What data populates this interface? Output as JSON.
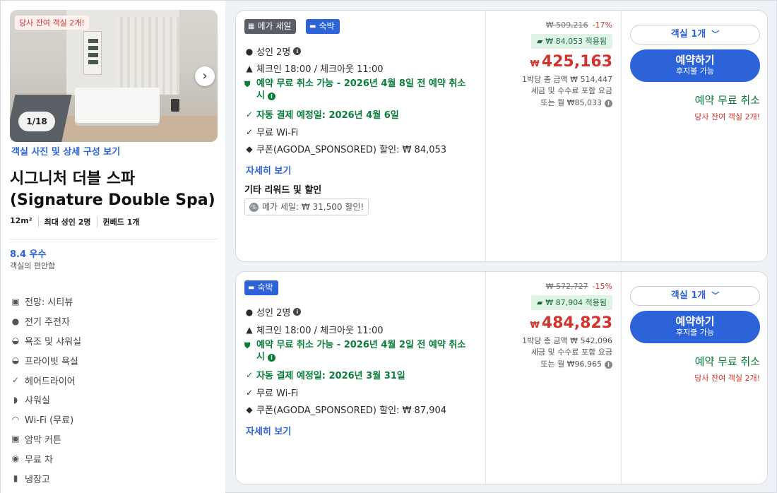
{
  "room": {
    "photo_badge": "당사 잔여 객실 2개!",
    "photo_counter": "1/18",
    "view_photos": "객실 사진 및 상세 구성 보기",
    "title": "시그니처 더블 스파 (Signature Double Spa)",
    "specs": [
      "12m²",
      "최대 성인 2명",
      "퀸베드 1개"
    ],
    "score": "8.4 우수",
    "score_sub": "객실의 편안함",
    "amenities": [
      {
        "icon": "view-icon",
        "label": "전망: 시티뷰"
      },
      {
        "icon": "plug-icon",
        "label": "전기 주전자"
      },
      {
        "icon": "bathtub-icon",
        "label": "욕조 및 샤워실"
      },
      {
        "icon": "bathtub-icon",
        "label": "프라이빗 욕실"
      },
      {
        "icon": "check-icon",
        "label": "헤어드라이어"
      },
      {
        "icon": "shower-icon",
        "label": "샤워실"
      },
      {
        "icon": "wifi-icon",
        "label": "Wi-Fi (무료)"
      },
      {
        "icon": "curtain-icon",
        "label": "암막 커튼"
      },
      {
        "icon": "tea-icon",
        "label": "무료 차"
      },
      {
        "icon": "fridge-icon",
        "label": "냉장고"
      }
    ]
  },
  "offers": [
    {
      "tags": [
        "메가 세일",
        "숙박"
      ],
      "adults": "성인 2명",
      "checkin": "체크인 18:00 / 체크아웃 11:00",
      "free_cancel": "예약 무료 취소 가능 - 2026년 4월 8일 전 예약 취소 시",
      "auto_pay": "자동 결제 예정일: 2026년 4월 6일",
      "wifi": "무료 Wi-Fi",
      "coupon": "쿠폰(AGODA_SPONSORED) 할인: ₩ 84,053",
      "details": "자세히 보기",
      "rewards_title": "기타 리워드 및 할인",
      "reward_chip": "메가 세일: ₩ 31,500 할인!",
      "original_price": "₩ 509,216",
      "discount_pct": "-17%",
      "coupon_applied": "₩ 84,053 적용됨",
      "currency": "₩",
      "price": "425,163",
      "note1": "1박당 총 금액 ₩ 514,447",
      "note2": "세금 및 수수료 포함 요금",
      "note3": "또는 월 ₩85,033",
      "room_select": "객실 1개",
      "book_main": "예약하기",
      "book_sub": "후지불 가능",
      "cancel_label": "예약 무료 취소",
      "rooms_left": "당사 잔여 객실 2개!"
    },
    {
      "tags": [
        "숙박"
      ],
      "adults": "성인 2명",
      "checkin": "체크인 18:00 / 체크아웃 11:00",
      "free_cancel": "예약 무료 취소 가능 - 2026년 4월 2일 전 예약 취소 시",
      "auto_pay": "자동 결제 예정일: 2026년 3월 31일",
      "wifi": "무료 Wi-Fi",
      "coupon": "쿠폰(AGODA_SPONSORED) 할인: ₩ 87,904",
      "details": "자세히 보기",
      "original_price": "₩ 572,727",
      "discount_pct": "-15%",
      "coupon_applied": "₩ 87,904 적용됨",
      "currency": "₩",
      "price": "484,823",
      "note1": "1박당 총 금액 ₩ 542,096",
      "note2": "세금 및 수수료 포함 요금",
      "note3": "또는 월 ₩96,965",
      "room_select": "객실 1개",
      "book_main": "예약하기",
      "book_sub": "후지불 가능",
      "cancel_label": "예약 무료 취소",
      "rooms_left": "당사 잔여 객실 2개!"
    }
  ]
}
